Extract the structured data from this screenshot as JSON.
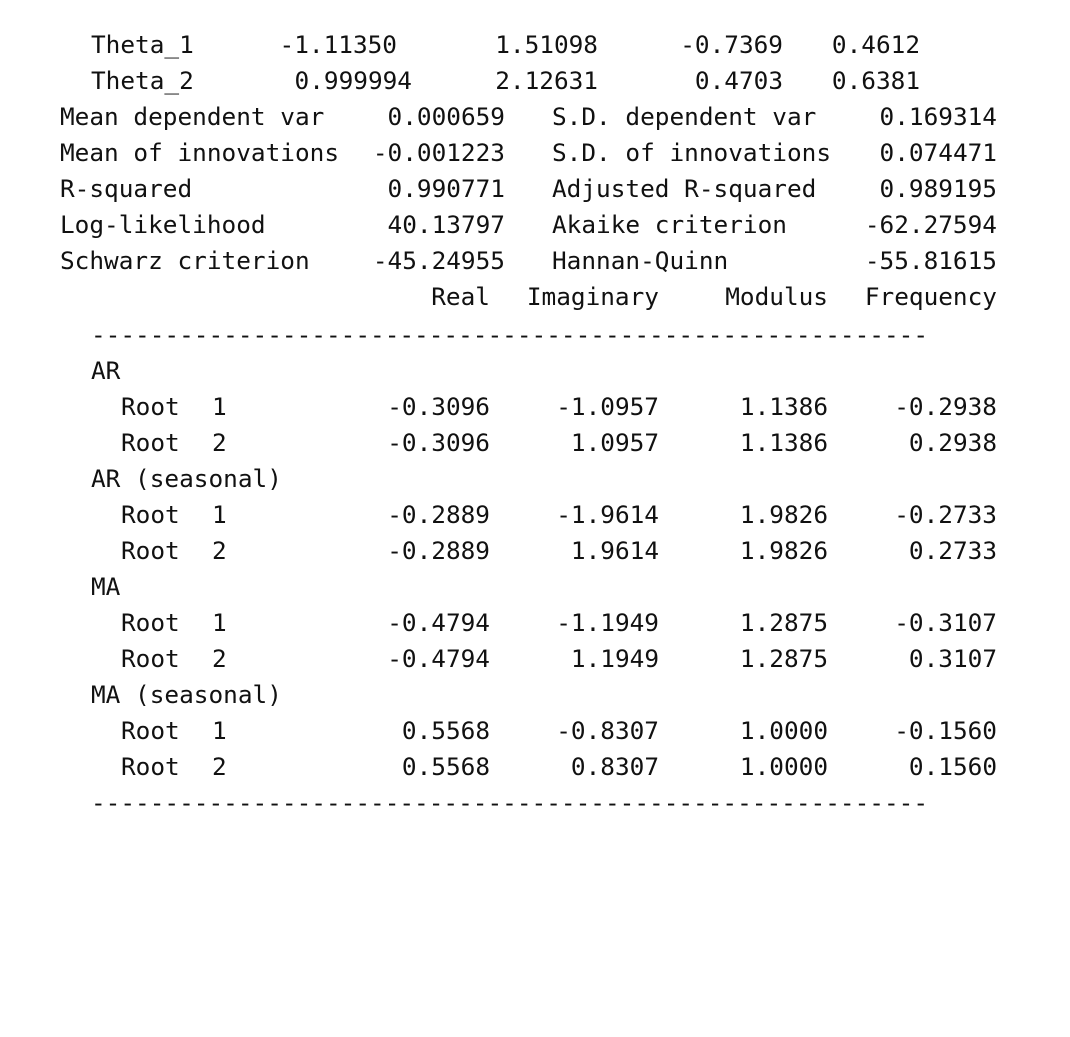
{
  "theta_rows": [
    {
      "name": "Theta_1",
      "coef": "-1.11350",
      "se": "1.51098",
      "z": "-0.7369",
      "p": "0.4612"
    },
    {
      "name": "Theta_2",
      "coef": "0.999994",
      "se": "2.12631",
      "z": "0.4703",
      "p": "0.6381"
    }
  ],
  "stats": [
    {
      "l1": "Mean dependent var",
      "v1": "0.000659",
      "l2": "S.D. dependent var",
      "v2": "0.169314"
    },
    {
      "l1": "Mean of innovations",
      "v1": "-0.001223",
      "l2": "S.D. of innovations",
      "v2": "0.074471"
    },
    {
      "l1": "R-squared",
      "v1": "0.990771",
      "l2": "Adjusted R-squared",
      "v2": "0.989195"
    },
    {
      "l1": "Log-likelihood",
      "v1": "40.13797",
      "l2": "Akaike criterion",
      "v2": "-62.27594"
    },
    {
      "l1": "Schwarz criterion",
      "v1": "-45.24955",
      "l2": "Hannan-Quinn",
      "v2": "-55.81615"
    }
  ],
  "roots_header": {
    "real": "Real",
    "imag": "Imaginary",
    "mod": "Modulus",
    "freq": "Frequency"
  },
  "separator": "---------------------------------------------------------",
  "root_groups": [
    {
      "label": "AR",
      "roots": [
        {
          "label": "Root",
          "num": "1",
          "real": "-0.3096",
          "imag": "-1.0957",
          "mod": "1.1386",
          "freq": "-0.2938"
        },
        {
          "label": "Root",
          "num": "2",
          "real": "-0.3096",
          "imag": "1.0957",
          "mod": "1.1386",
          "freq": "0.2938"
        }
      ]
    },
    {
      "label": "AR (seasonal)",
      "roots": [
        {
          "label": "Root",
          "num": "1",
          "real": "-0.2889",
          "imag": "-1.9614",
          "mod": "1.9826",
          "freq": "-0.2733"
        },
        {
          "label": "Root",
          "num": "2",
          "real": "-0.2889",
          "imag": "1.9614",
          "mod": "1.9826",
          "freq": "0.2733"
        }
      ]
    },
    {
      "label": "MA",
      "roots": [
        {
          "label": "Root",
          "num": "1",
          "real": "-0.4794",
          "imag": "-1.1949",
          "mod": "1.2875",
          "freq": "-0.3107"
        },
        {
          "label": "Root",
          "num": "2",
          "real": "-0.4794",
          "imag": "1.1949",
          "mod": "1.2875",
          "freq": "0.3107"
        }
      ]
    },
    {
      "label": "MA (seasonal)",
      "roots": [
        {
          "label": "Root",
          "num": "1",
          "real": "0.5568",
          "imag": "-0.8307",
          "mod": "1.0000",
          "freq": "-0.1560"
        },
        {
          "label": "Root",
          "num": "2",
          "real": "0.5568",
          "imag": "0.8307",
          "mod": "1.0000",
          "freq": "0.1560"
        }
      ]
    }
  ]
}
